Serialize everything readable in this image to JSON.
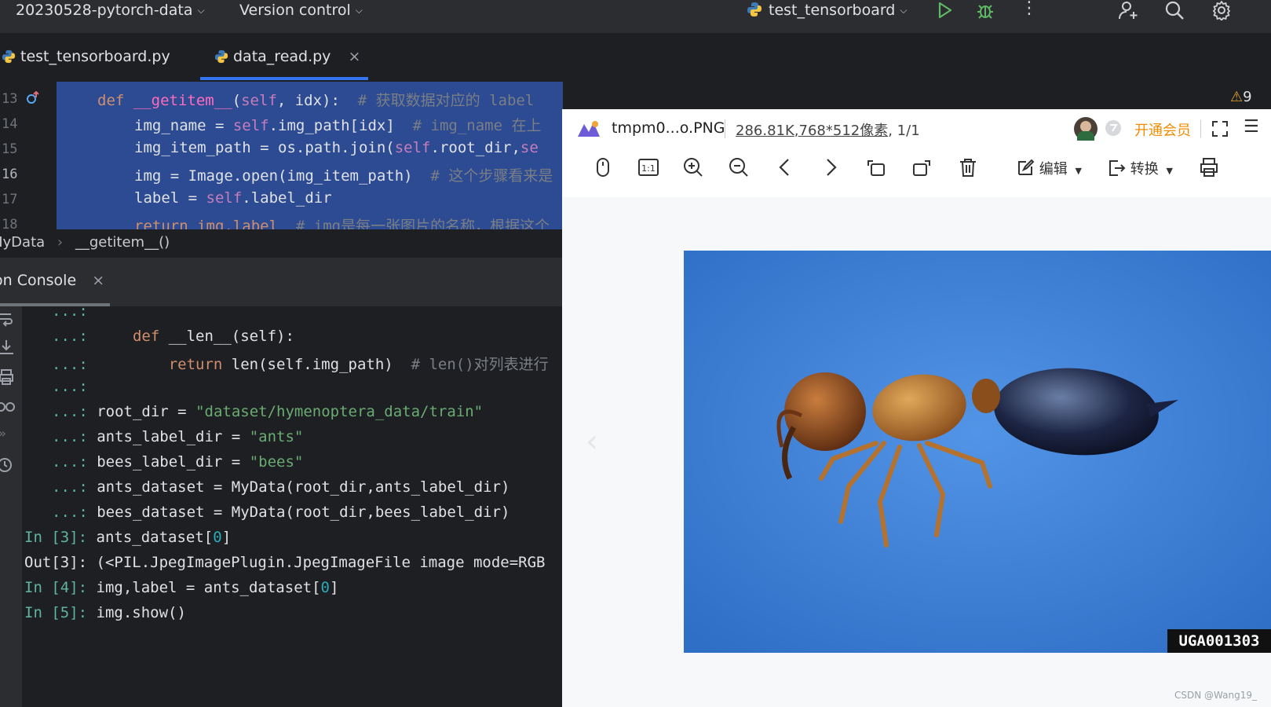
{
  "toolbar": {
    "project": "20230528-pytorch-data",
    "vcs": "Version control",
    "run_config": "test_tensorboard"
  },
  "tabs": [
    {
      "label": "test_tensorboard.py"
    },
    {
      "label": "data_read.py",
      "close": "×"
    }
  ],
  "editor": {
    "line_numbers": [
      "13",
      "14",
      "15",
      "16",
      "17",
      "18"
    ],
    "line13": {
      "kw": "def ",
      "name": "__getitem__",
      "args_open": "(",
      "self": "self",
      "args_rest": ", idx):",
      "comment": "# 获取数据对应的 label"
    },
    "line14": {
      "pre": "img_name = ",
      "self": "self",
      "post": ".img_path[idx]",
      "comment": "# img_name 在上"
    },
    "line15": {
      "pre": "img_item_path = os.path.join(",
      "self": "self",
      "post": ".root_dir,",
      "tail": "se"
    },
    "line16": {
      "pre": "img = Image.open(img_item_path)",
      "comment": "# 这个步骤看来是"
    },
    "line17": {
      "pre": "label = ",
      "self": "self",
      "post": ".label_dir"
    },
    "line18": {
      "pre": "return img,label",
      "comment": "# img是每一张图片的名称，根据这个"
    }
  },
  "warning_count": "9",
  "breadcrumb": {
    "class": "MyData",
    "method": "__getitem__()"
  },
  "console": {
    "tab_label": "on Console",
    "close": "×",
    "lines": [
      {
        "prompt": "...:",
        "code": ""
      },
      {
        "prompt": "...:",
        "kw": "def ",
        "code": "__len__(self):"
      },
      {
        "prompt": "...:",
        "kw": "return ",
        "code": "len(self.img_path)",
        "comment": "# len()对列表进行"
      },
      {
        "prompt": "...:",
        "code": ""
      },
      {
        "prompt": "...:",
        "code": "root_dir = ",
        "str": "\"dataset/hymenoptera_data/train\""
      },
      {
        "prompt": "...:",
        "code": "ants_label_dir = ",
        "str": "\"ants\""
      },
      {
        "prompt": "...:",
        "code": "bees_label_dir = ",
        "str": "\"bees\""
      },
      {
        "prompt": "...:",
        "code": "ants_dataset = MyData(root_dir,ants_label_dir)"
      },
      {
        "prompt": "...:",
        "code": "bees_dataset = MyData(root_dir,bees_label_dir)"
      },
      {
        "prompt": "In [3]:",
        "code": "ants_dataset[",
        "num": "0",
        "tail": "]"
      },
      {
        "prompt": "Out[3]:",
        "code": "(<PIL.JpegImagePlugin.JpegImageFile image mode=RGB"
      },
      {
        "prompt": "In [4]:",
        "code": "img,label = ants_dataset[",
        "num": "0",
        "tail": "]"
      },
      {
        "prompt": "In [5]:",
        "code": "img.show()"
      }
    ]
  },
  "viewer": {
    "filename": "tmpm0...o.PNG",
    "filesize": "286.81K",
    "dimensions": ",768*512像素",
    "page": ", 1/1",
    "vip": "开通会员",
    "edit_label": "编辑",
    "convert_label": "转换",
    "watermark": "UGA001303",
    "credit": "CSDN @Wang19_"
  },
  "colors": {
    "editor_selection": "#2c4b93",
    "accent": "#3574f0",
    "vip_orange": "#f08c00"
  }
}
